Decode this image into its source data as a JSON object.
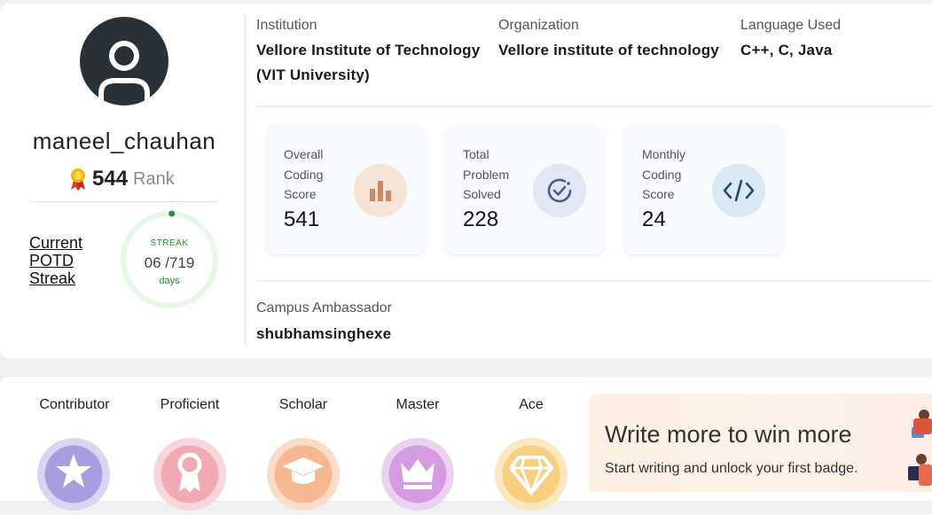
{
  "profile": {
    "username": "maneel_chauhan",
    "rank_value": "544",
    "rank_label": "Rank",
    "potd_label": "Current POTD Streak",
    "streak": {
      "title": "STREAK",
      "value": "06 /719",
      "unit": "days",
      "progress": 0.0083
    }
  },
  "info": {
    "institution_label": "Institution",
    "institution_value": "Vellore Institute of Technology (VIT University)",
    "organization_label": "Organization",
    "organization_value": "Vellore institute of technology",
    "language_label": "Language Used",
    "language_value": "C++, C, Java",
    "campus_label": "Campus Ambassador",
    "campus_value": "shubhamsinghexe"
  },
  "stats": [
    {
      "label": "Overall Coding Score",
      "value": "541",
      "icon": "bar-chart-icon"
    },
    {
      "label": "Total Problem Solved",
      "value": "228",
      "icon": "check-circle-icon"
    },
    {
      "label": "Monthly Coding Score",
      "value": "24",
      "icon": "code-icon"
    }
  ],
  "badges": [
    {
      "name": "Contributor",
      "icon": "star-icon"
    },
    {
      "name": "Proficient",
      "icon": "award-ribbon-icon"
    },
    {
      "name": "Scholar",
      "icon": "graduation-cap-icon"
    },
    {
      "name": "Master",
      "icon": "crown-icon"
    },
    {
      "name": "Ace",
      "icon": "diamond-icon"
    }
  ],
  "promo": {
    "title": "Write more to win more",
    "subtitle": "Start writing and unlock your first badge."
  },
  "colors": {
    "streak_green": "#2e8b3d",
    "streak_ring": "#e6f7e8",
    "avatar_bg": "#2b3237"
  }
}
